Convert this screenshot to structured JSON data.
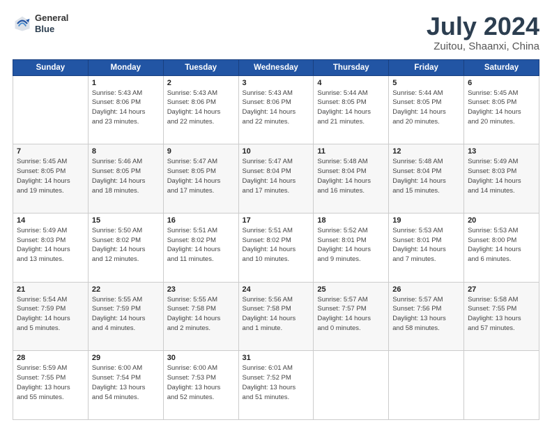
{
  "header": {
    "logo_line1": "General",
    "logo_line2": "Blue",
    "title": "July 2024",
    "subtitle": "Zuitou, Shaanxi, China"
  },
  "weekdays": [
    "Sunday",
    "Monday",
    "Tuesday",
    "Wednesday",
    "Thursday",
    "Friday",
    "Saturday"
  ],
  "weeks": [
    [
      {
        "day": "",
        "info": ""
      },
      {
        "day": "1",
        "info": "Sunrise: 5:43 AM\nSunset: 8:06 PM\nDaylight: 14 hours\nand 23 minutes."
      },
      {
        "day": "2",
        "info": "Sunrise: 5:43 AM\nSunset: 8:06 PM\nDaylight: 14 hours\nand 22 minutes."
      },
      {
        "day": "3",
        "info": "Sunrise: 5:43 AM\nSunset: 8:06 PM\nDaylight: 14 hours\nand 22 minutes."
      },
      {
        "day": "4",
        "info": "Sunrise: 5:44 AM\nSunset: 8:05 PM\nDaylight: 14 hours\nand 21 minutes."
      },
      {
        "day": "5",
        "info": "Sunrise: 5:44 AM\nSunset: 8:05 PM\nDaylight: 14 hours\nand 20 minutes."
      },
      {
        "day": "6",
        "info": "Sunrise: 5:45 AM\nSunset: 8:05 PM\nDaylight: 14 hours\nand 20 minutes."
      }
    ],
    [
      {
        "day": "7",
        "info": "Sunrise: 5:45 AM\nSunset: 8:05 PM\nDaylight: 14 hours\nand 19 minutes."
      },
      {
        "day": "8",
        "info": "Sunrise: 5:46 AM\nSunset: 8:05 PM\nDaylight: 14 hours\nand 18 minutes."
      },
      {
        "day": "9",
        "info": "Sunrise: 5:47 AM\nSunset: 8:05 PM\nDaylight: 14 hours\nand 17 minutes."
      },
      {
        "day": "10",
        "info": "Sunrise: 5:47 AM\nSunset: 8:04 PM\nDaylight: 14 hours\nand 17 minutes."
      },
      {
        "day": "11",
        "info": "Sunrise: 5:48 AM\nSunset: 8:04 PM\nDaylight: 14 hours\nand 16 minutes."
      },
      {
        "day": "12",
        "info": "Sunrise: 5:48 AM\nSunset: 8:04 PM\nDaylight: 14 hours\nand 15 minutes."
      },
      {
        "day": "13",
        "info": "Sunrise: 5:49 AM\nSunset: 8:03 PM\nDaylight: 14 hours\nand 14 minutes."
      }
    ],
    [
      {
        "day": "14",
        "info": "Sunrise: 5:49 AM\nSunset: 8:03 PM\nDaylight: 14 hours\nand 13 minutes."
      },
      {
        "day": "15",
        "info": "Sunrise: 5:50 AM\nSunset: 8:02 PM\nDaylight: 14 hours\nand 12 minutes."
      },
      {
        "day": "16",
        "info": "Sunrise: 5:51 AM\nSunset: 8:02 PM\nDaylight: 14 hours\nand 11 minutes."
      },
      {
        "day": "17",
        "info": "Sunrise: 5:51 AM\nSunset: 8:02 PM\nDaylight: 14 hours\nand 10 minutes."
      },
      {
        "day": "18",
        "info": "Sunrise: 5:52 AM\nSunset: 8:01 PM\nDaylight: 14 hours\nand 9 minutes."
      },
      {
        "day": "19",
        "info": "Sunrise: 5:53 AM\nSunset: 8:01 PM\nDaylight: 14 hours\nand 7 minutes."
      },
      {
        "day": "20",
        "info": "Sunrise: 5:53 AM\nSunset: 8:00 PM\nDaylight: 14 hours\nand 6 minutes."
      }
    ],
    [
      {
        "day": "21",
        "info": "Sunrise: 5:54 AM\nSunset: 7:59 PM\nDaylight: 14 hours\nand 5 minutes."
      },
      {
        "day": "22",
        "info": "Sunrise: 5:55 AM\nSunset: 7:59 PM\nDaylight: 14 hours\nand 4 minutes."
      },
      {
        "day": "23",
        "info": "Sunrise: 5:55 AM\nSunset: 7:58 PM\nDaylight: 14 hours\nand 2 minutes."
      },
      {
        "day": "24",
        "info": "Sunrise: 5:56 AM\nSunset: 7:58 PM\nDaylight: 14 hours\nand 1 minute."
      },
      {
        "day": "25",
        "info": "Sunrise: 5:57 AM\nSunset: 7:57 PM\nDaylight: 14 hours\nand 0 minutes."
      },
      {
        "day": "26",
        "info": "Sunrise: 5:57 AM\nSunset: 7:56 PM\nDaylight: 13 hours\nand 58 minutes."
      },
      {
        "day": "27",
        "info": "Sunrise: 5:58 AM\nSunset: 7:55 PM\nDaylight: 13 hours\nand 57 minutes."
      }
    ],
    [
      {
        "day": "28",
        "info": "Sunrise: 5:59 AM\nSunset: 7:55 PM\nDaylight: 13 hours\nand 55 minutes."
      },
      {
        "day": "29",
        "info": "Sunrise: 6:00 AM\nSunset: 7:54 PM\nDaylight: 13 hours\nand 54 minutes."
      },
      {
        "day": "30",
        "info": "Sunrise: 6:00 AM\nSunset: 7:53 PM\nDaylight: 13 hours\nand 52 minutes."
      },
      {
        "day": "31",
        "info": "Sunrise: 6:01 AM\nSunset: 7:52 PM\nDaylight: 13 hours\nand 51 minutes."
      },
      {
        "day": "",
        "info": ""
      },
      {
        "day": "",
        "info": ""
      },
      {
        "day": "",
        "info": ""
      }
    ]
  ]
}
